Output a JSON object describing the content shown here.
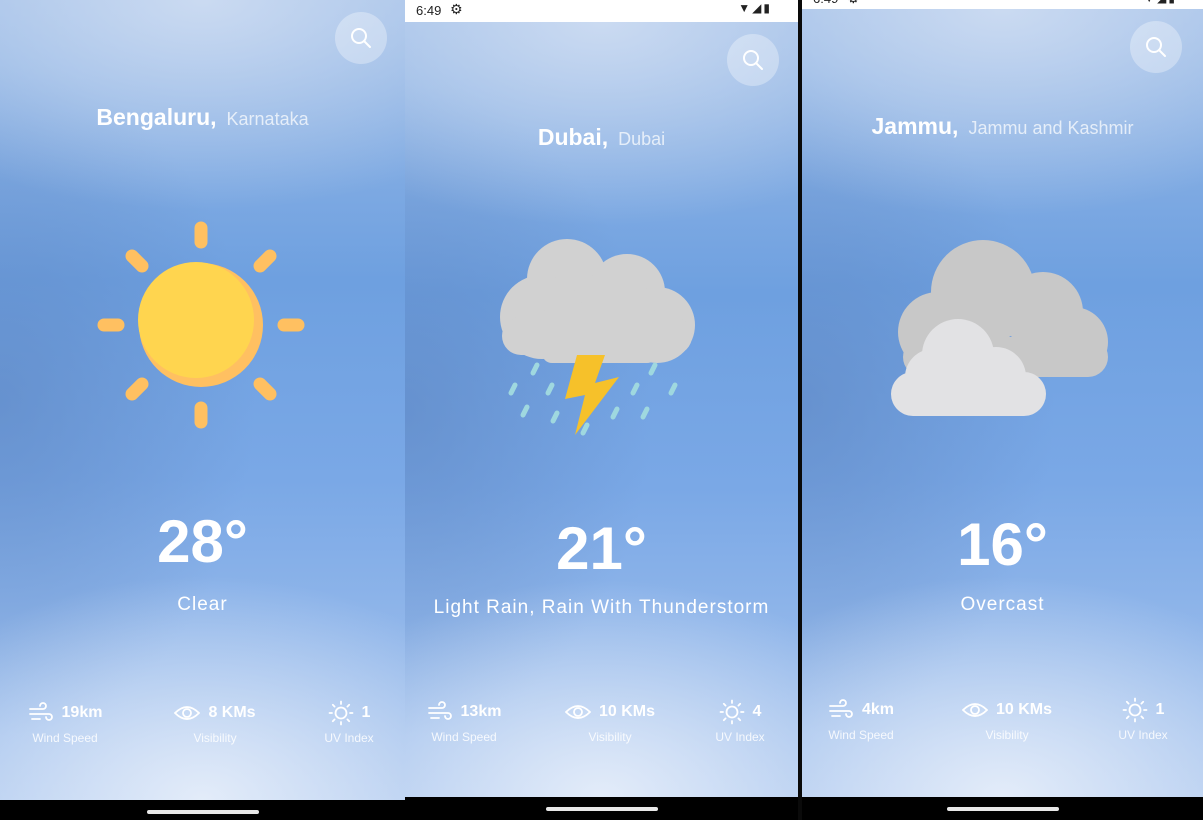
{
  "status": {
    "time": "6:49",
    "gear_icon": "gear-icon",
    "signal_icons": "wifi-icon cell-icon battery-icon"
  },
  "screens": [
    {
      "city": "Bengaluru,",
      "region": "Karnataka",
      "icon": "sun-icon",
      "temp": "28°",
      "condition": "Clear",
      "stats": {
        "wind": {
          "value": "19km",
          "label": "Wind Speed"
        },
        "visibility": {
          "value": "8 KMs",
          "label": "Visibility"
        },
        "uv": {
          "value": "1",
          "label": "UV Index"
        }
      }
    },
    {
      "city": "Dubai,",
      "region": "Dubai",
      "icon": "thunderstorm-icon",
      "temp": "21°",
      "condition": "Light Rain, Rain With Thunderstorm",
      "stats": {
        "wind": {
          "value": "13km",
          "label": "Wind Speed"
        },
        "visibility": {
          "value": "10 KMs",
          "label": "Visibility"
        },
        "uv": {
          "value": "4",
          "label": "UV Index"
        }
      }
    },
    {
      "city": "Jammu,",
      "region": "Jammu and Kashmir",
      "icon": "overcast-clouds-icon",
      "temp": "16°",
      "condition": "Overcast",
      "stats": {
        "wind": {
          "value": "4km",
          "label": "Wind Speed"
        },
        "visibility": {
          "value": "10 KMs",
          "label": "Visibility"
        },
        "uv": {
          "value": "1",
          "label": "UV Index"
        }
      }
    }
  ],
  "colors": {
    "sun": "#ffd54f",
    "sun_shade": "#ffc061",
    "cloud": "#d1d1d1",
    "bolt": "#f6c12a",
    "rain": "#9fd8df"
  }
}
